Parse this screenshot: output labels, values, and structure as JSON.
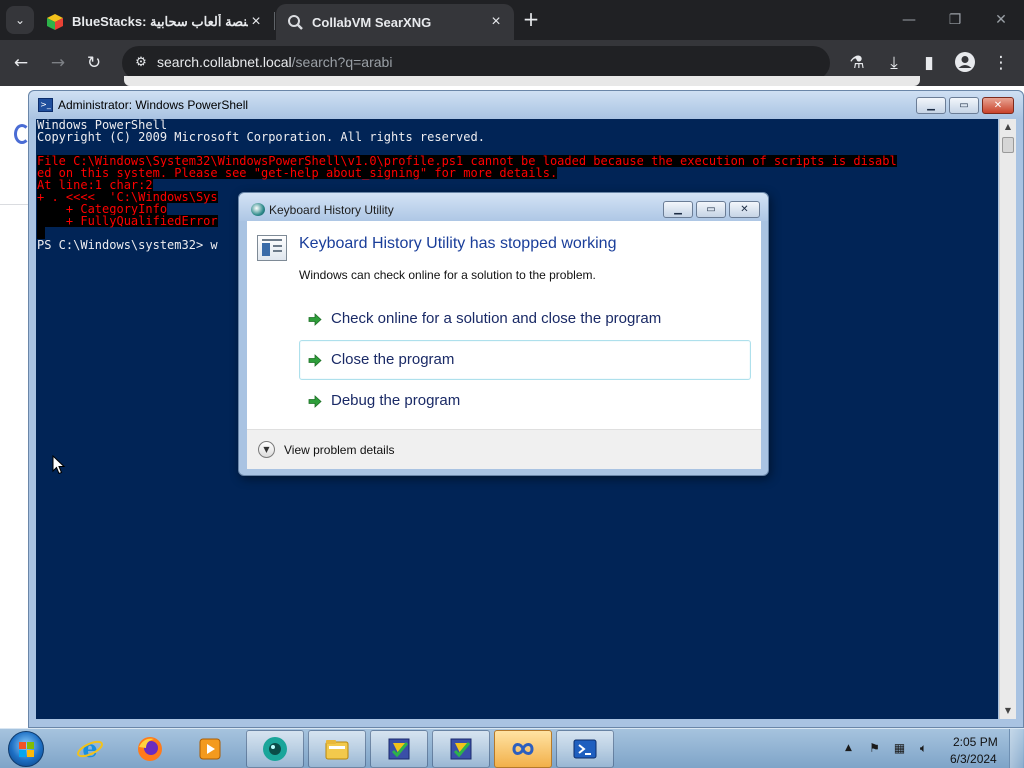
{
  "browser": {
    "tabs": [
      {
        "title": "BlueStacks: ويد، منصة ألعاب سحابية",
        "favicon": "bluestacks-icon"
      },
      {
        "title": "CollabVM SearXNG",
        "favicon": "searxng-icon"
      }
    ],
    "url_host": "search.collabnet.local",
    "url_path": "/search?q=arabi"
  },
  "powershell": {
    "title": "Administrator: Windows PowerShell",
    "lines": [
      {
        "text": "Windows PowerShell",
        "kind": "normal"
      },
      {
        "text": "Copyright (C) 2009 Microsoft Corporation. All rights reserved.",
        "kind": "normal"
      },
      {
        "text": "",
        "kind": "normal"
      },
      {
        "text": "File C:\\Windows\\System32\\WindowsPowerShell\\v1.0\\profile.ps1 cannot be loaded because the execution of scripts is disabl",
        "kind": "err"
      },
      {
        "text": "ed on this system. Please see \"get-help about_signing\" for more details.",
        "kind": "err"
      },
      {
        "text": "At line:1 char:2",
        "kind": "err"
      },
      {
        "text": "+ . <<<<  'C:\\Windows\\Sys",
        "kind": "err"
      },
      {
        "text": "    + CategoryInfo",
        "kind": "err"
      },
      {
        "text": "    + FullyQualifiedError",
        "kind": "err"
      },
      {
        "text": "",
        "kind": "err"
      },
      {
        "text": "PS C:\\Windows\\system32> w",
        "kind": "normal"
      }
    ]
  },
  "dialog": {
    "title": "Keyboard History Utility",
    "heading": "Keyboard History Utility has stopped working",
    "subtext": "Windows can check online for a solution to the problem.",
    "options": [
      {
        "label": "Check online for a solution and close the program",
        "hover": false
      },
      {
        "label": "Close the program",
        "hover": true
      },
      {
        "label": "Debug the program",
        "hover": false
      }
    ],
    "details_label": "View problem details"
  },
  "taskbar": {
    "items": [
      "internet-explorer-icon",
      "firefox-icon",
      "media-player-icon",
      "webcam-icon",
      "file-explorer-icon",
      "cpu-z-icon",
      "cpu-z-icon",
      "infinity-icon",
      "powershell-icon"
    ],
    "time": "2:05 PM",
    "date": "6/3/2024"
  },
  "colors": {
    "console_bg": "#012456",
    "console_fg": "#eeedf0",
    "error_fg": "#ff0000",
    "link_blue": "#1a3e9a"
  }
}
